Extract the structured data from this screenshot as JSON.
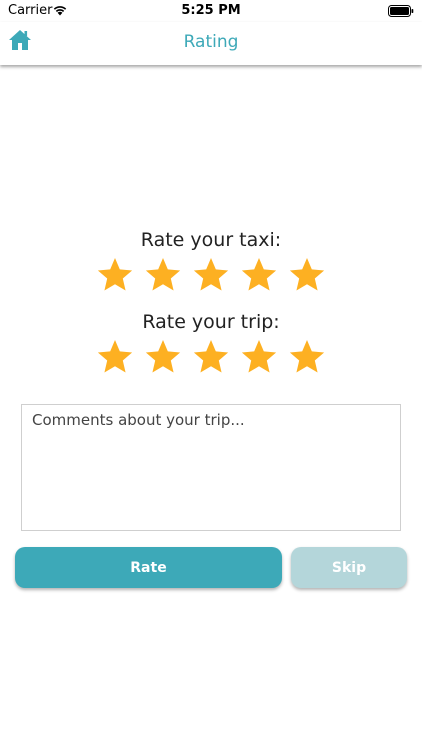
{
  "status_bar": {
    "carrier": "Carrier",
    "time": "5:25 PM"
  },
  "nav": {
    "title": "Rating",
    "home_icon": "home-icon"
  },
  "taxi_rating": {
    "label": "Rate your taxi:",
    "value": 5,
    "max": 5
  },
  "trip_rating": {
    "label": "Rate your trip:",
    "value": 5,
    "max": 5
  },
  "comments": {
    "placeholder": "Comments about your trip...",
    "value": ""
  },
  "buttons": {
    "rate": "Rate",
    "skip": "Skip"
  },
  "colors": {
    "accent": "#3da9b8",
    "star": "#fdb022",
    "skip": "#b4d6da"
  }
}
